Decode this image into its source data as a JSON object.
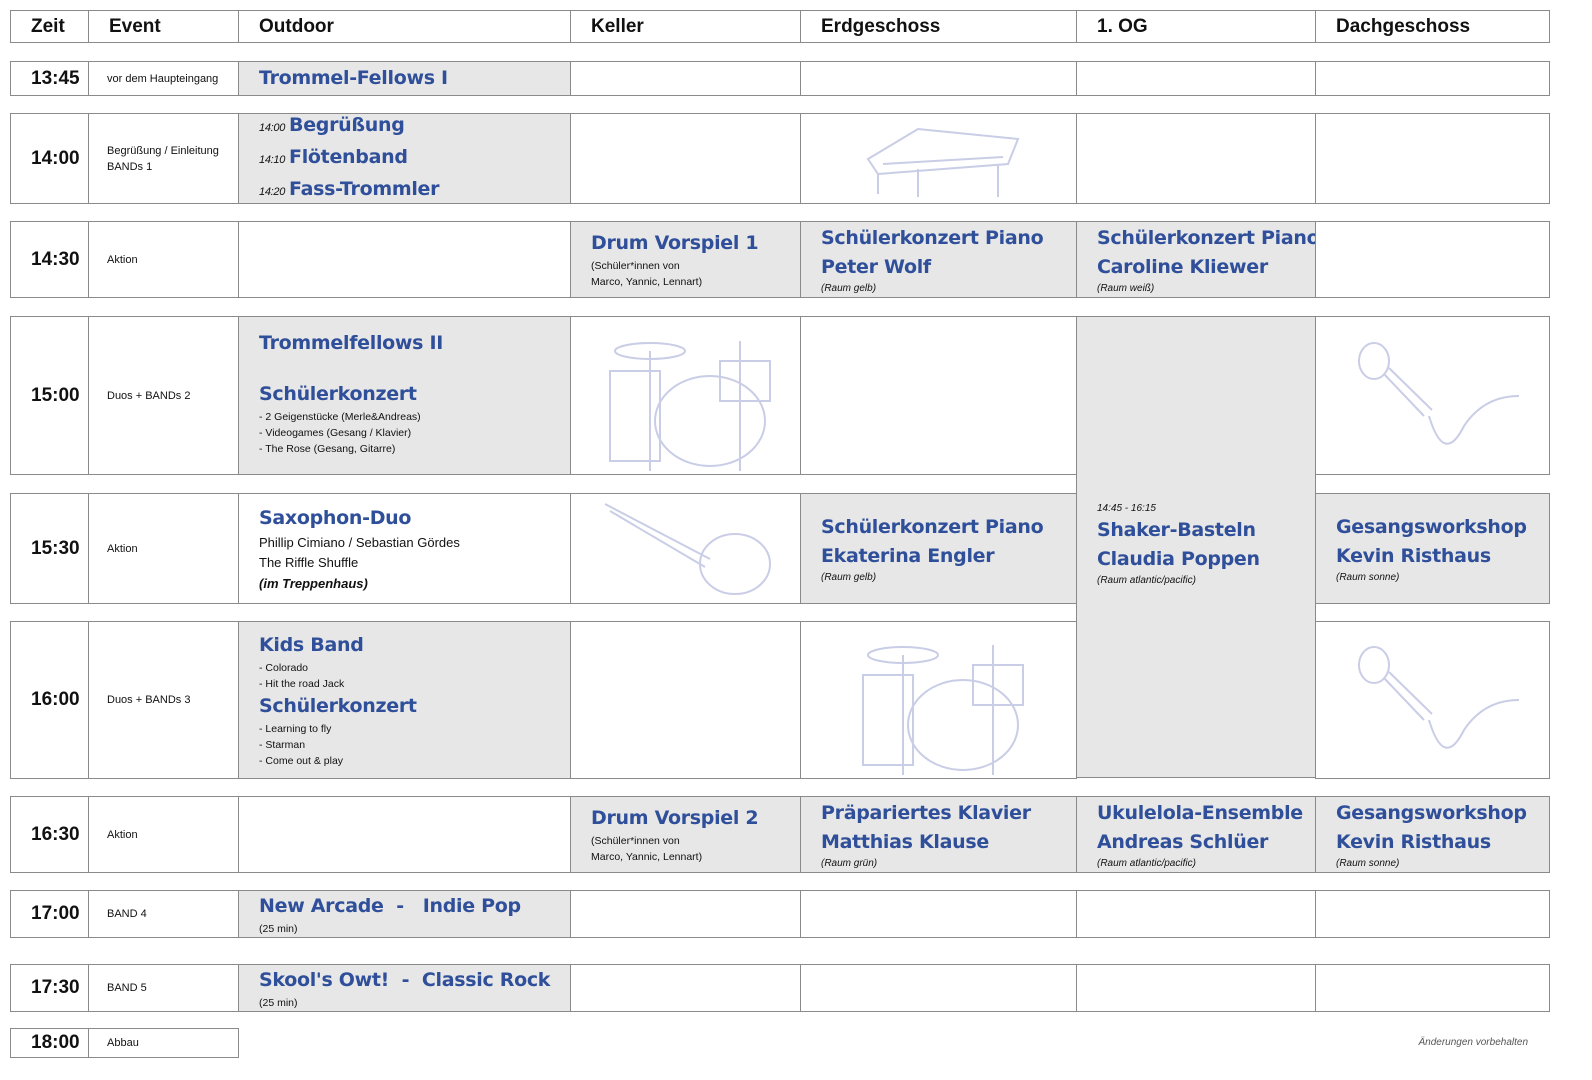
{
  "header": [
    "Zeit",
    "Event",
    "Outdoor",
    "Keller",
    "Erdgeschoss",
    "1. OG",
    "Dachgeschoss"
  ],
  "colors": {
    "title_blue": "#2f4f9a",
    "cell_gray": "#e7e7e7",
    "sketch": "#c9cde6"
  },
  "rows": [
    {
      "time": "13:45",
      "event": [
        "vor dem Haupteingang"
      ],
      "cells": {
        "outdoor": [
          {
            "k": "title",
            "v": "Trommel-Fellows I"
          }
        ]
      }
    },
    {
      "time": "14:00",
      "event": [
        "Begrüßung / Einleitung",
        "BANDs 1"
      ],
      "cells": {
        "outdoor": [
          {
            "k": "title",
            "pre": "14:00",
            "v": "Begrüßung"
          },
          {
            "k": "title",
            "pre": "14:10",
            "v": "Flötenband"
          },
          {
            "k": "title",
            "pre": "14:20",
            "v": "Fass-Trommler"
          }
        ]
      }
    },
    {
      "time": "14:30",
      "event": [
        "Aktion"
      ],
      "cells": {
        "keller": [
          {
            "k": "title",
            "v": "Drum Vorspiel 1"
          },
          {
            "k": "small",
            "v": "(Schüler*innen von"
          },
          {
            "k": "small",
            "v": "Marco, Yannic, Lennart)"
          }
        ],
        "erd": [
          {
            "k": "title",
            "v": "Schülerkonzert Piano"
          },
          {
            "k": "title",
            "v": "Peter Wolf"
          },
          {
            "k": "note",
            "v": "(Raum gelb)"
          }
        ],
        "og": [
          {
            "k": "title",
            "v": "Schülerkonzert Piano"
          },
          {
            "k": "title",
            "v": "Caroline Kliewer"
          },
          {
            "k": "note",
            "v": "(Raum weiß)"
          }
        ]
      }
    },
    {
      "time": "15:00",
      "event": [
        "Duos + BANDs 2"
      ],
      "cells": {
        "outdoor": [
          {
            "k": "title",
            "v": "Trommelfellows II"
          },
          {
            "k": "spacer",
            "v": ""
          },
          {
            "k": "title",
            "v": "Schülerkonzert"
          },
          {
            "k": "small",
            "v": "- 2 Geigenstücke (Merle&Andreas)"
          },
          {
            "k": "small",
            "v": "- Videogames (Gesang / Klavier)"
          },
          {
            "k": "small",
            "v": "- The Rose (Gesang, Gitarre)"
          }
        ],
        "og": [
          {
            "k": "note",
            "v": "14:45 - 16:15"
          },
          {
            "k": "title",
            "v": "Shaker-Basteln"
          },
          {
            "k": "title",
            "v": "Claudia Poppen"
          },
          {
            "k": "note",
            "v": "(Raum atlantic/pacific)"
          }
        ]
      }
    },
    {
      "time": "15:30",
      "event": [
        "Aktion"
      ],
      "cells": {
        "outdoor": [
          {
            "k": "title",
            "v": "Saxophon-Duo"
          },
          {
            "k": "text",
            "v": "Phillip Cimiano / Sebastian Gördes"
          },
          {
            "k": "text",
            "v": "The Riffle Shuffle"
          },
          {
            "k": "textbi",
            "v": "(im Treppenhaus)"
          }
        ],
        "erd": [
          {
            "k": "title",
            "v": "Schülerkonzert Piano"
          },
          {
            "k": "title",
            "v": "Ekaterina Engler"
          },
          {
            "k": "note",
            "v": "(Raum gelb)"
          }
        ],
        "dach": [
          {
            "k": "title",
            "v": "Gesangsworkshop"
          },
          {
            "k": "title",
            "v": "Kevin Risthaus"
          },
          {
            "k": "note",
            "v": "(Raum sonne)"
          }
        ]
      }
    },
    {
      "time": "16:00",
      "event": [
        "Duos + BANDs 3"
      ],
      "cells": {
        "outdoor": [
          {
            "k": "title",
            "v": "Kids Band"
          },
          {
            "k": "small",
            "v": "- Colorado"
          },
          {
            "k": "small",
            "v": "- Hit the road Jack"
          },
          {
            "k": "title",
            "v": "Schülerkonzert"
          },
          {
            "k": "small",
            "v": "- Learning to fly"
          },
          {
            "k": "small",
            "v": "- Starman"
          },
          {
            "k": "small",
            "v": "- Come out & play"
          }
        ]
      }
    },
    {
      "time": "16:30",
      "event": [
        "Aktion"
      ],
      "cells": {
        "keller": [
          {
            "k": "title",
            "v": "Drum Vorspiel 2"
          },
          {
            "k": "small",
            "v": "(Schüler*innen von"
          },
          {
            "k": "small",
            "v": "Marco, Yannic, Lennart)"
          }
        ],
        "erd": [
          {
            "k": "title",
            "v": "Präpariertes Klavier"
          },
          {
            "k": "title",
            "v": "Matthias Klause"
          },
          {
            "k": "note",
            "v": "(Raum grün)"
          }
        ],
        "og": [
          {
            "k": "title",
            "v": "Ukulelola-Ensemble"
          },
          {
            "k": "title",
            "v": "Andreas Schlüer"
          },
          {
            "k": "note",
            "v": "(Raum  atlantic/pacific)"
          }
        ],
        "dach": [
          {
            "k": "title",
            "v": "Gesangsworkshop"
          },
          {
            "k": "title",
            "v": "Kevin Risthaus"
          },
          {
            "k": "note",
            "v": "(Raum sonne)"
          }
        ]
      }
    },
    {
      "time": "17:00",
      "event": [
        "BAND 4"
      ],
      "cells": {
        "outdoor": [
          {
            "k": "title",
            "v": "New Arcade  -   Indie Pop"
          },
          {
            "k": "small",
            "v": "(25 min)"
          }
        ]
      }
    },
    {
      "time": "17:30",
      "event": [
        "BAND 5"
      ],
      "cells": {
        "outdoor": [
          {
            "k": "title",
            "v": "Skool's Owt!  -  Classic Rock"
          },
          {
            "k": "small",
            "v": "(25 min)"
          }
        ]
      }
    },
    {
      "time": "18:00",
      "event": [
        "Abbau"
      ],
      "cells": {}
    }
  ],
  "illustrations": [
    {
      "row": 1,
      "col": "erd",
      "icon": "piano-sketch"
    },
    {
      "row": 3,
      "col": "keller",
      "icon": "drums-sketch"
    },
    {
      "row": 3,
      "col": "dach",
      "icon": "microphone-sketch"
    },
    {
      "row": 4,
      "col": "keller",
      "icon": "guitar-sketch"
    },
    {
      "row": 5,
      "col": "erd",
      "icon": "drums-sketch"
    },
    {
      "row": 5,
      "col": "dach",
      "icon": "microphone-sketch"
    }
  ],
  "footer": "Änderungen vorbehalten"
}
